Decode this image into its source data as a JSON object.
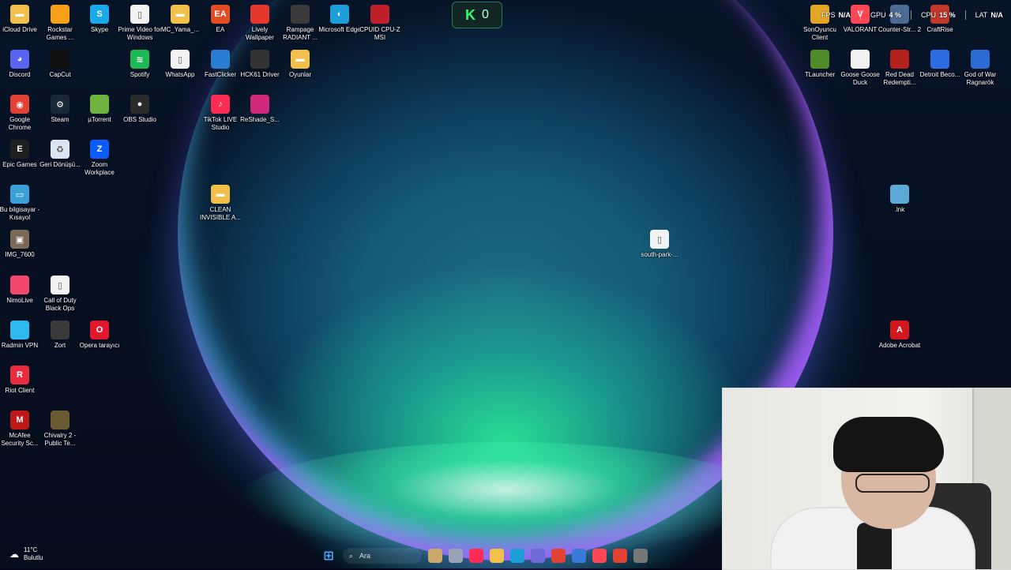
{
  "desktop": {
    "icons_left": [
      {
        "label": "iCloud Drive",
        "icon": "folder-icon",
        "color": "#f2c04a"
      },
      {
        "label": "Rockstar Games ...",
        "icon": "rockstar-icon",
        "color": "#f7a11a"
      },
      {
        "label": "Skype",
        "icon": "skype-icon",
        "color": "#19a8e8"
      },
      {
        "label": "Prime Video for Windows",
        "icon": "file-icon",
        "color": "#f2f2f2"
      },
      {
        "label": "MC_Yama_...",
        "icon": "folder-icon",
        "color": "#f2c04a"
      },
      {
        "label": "EA",
        "icon": "ea-icon",
        "color": "#e34b25"
      },
      {
        "label": "Lively Wallpaper",
        "icon": "lively-icon",
        "color": "#e6382d"
      },
      {
        "label": "Rampage RADIANT ...",
        "icon": "rampage-icon",
        "color": "#3a3a3a"
      },
      {
        "label": "Microsoft Edge",
        "icon": "edge-icon",
        "color": "#1c9ed8"
      },
      {
        "label": "CPUID CPU-Z MSI",
        "icon": "cpuz-icon",
        "color": "#c0202a"
      },
      {
        "label": "Discord",
        "icon": "discord-icon",
        "color": "#5865f2"
      },
      {
        "label": "CapCut",
        "icon": "capcut-icon",
        "color": "#101010"
      },
      {
        "label": "Spotify",
        "icon": "spotify-icon",
        "color": "#1db954"
      },
      {
        "label": "WhatsApp",
        "icon": "file-icon",
        "color": "#f2f2f2"
      },
      {
        "label": "FastClicker",
        "icon": "fastclicker-icon",
        "color": "#2a7bd2"
      },
      {
        "label": "HCK61 Driver",
        "icon": "hck-icon",
        "color": "#333333"
      },
      {
        "label": "Oyunlar",
        "icon": "folder-icon",
        "color": "#f2c04a"
      },
      {
        "label": "Google Chrome",
        "icon": "chrome-icon",
        "color": "#e34133"
      },
      {
        "label": "Steam",
        "icon": "steam-icon",
        "color": "#1b2838"
      },
      {
        "label": "µTorrent",
        "icon": "utorrent-icon",
        "color": "#6fb33f"
      },
      {
        "label": "OBS Studio",
        "icon": "obs-icon",
        "color": "#2b2b2b"
      },
      {
        "label": "TikTok LIVE Studio",
        "icon": "tiktok-icon",
        "color": "#fe2c55"
      },
      {
        "label": "ReShade_S...",
        "icon": "reshade-icon",
        "color": "#d22a7a"
      },
      {
        "label": "Epic Games",
        "icon": "epic-icon",
        "color": "#1f1f1f"
      },
      {
        "label": "Geri Dönüşü...",
        "icon": "recycle-bin-icon",
        "color": "#d9e6f2"
      },
      {
        "label": "Zoom Workplace",
        "icon": "zoom-icon",
        "color": "#0b5cff"
      },
      {
        "label": "Bu bilgisayar - Kısayol",
        "icon": "computer-icon",
        "color": "#3aa0d8"
      },
      {
        "label": "CLEAN INVISIBLE A...",
        "icon": "folder-icon",
        "color": "#f2c04a"
      },
      {
        "label": "IMG_7600",
        "icon": "image-icon",
        "color": "#7a6a55"
      },
      {
        "label": "south-park-...",
        "icon": "file-icon",
        "color": "#f2f2f2"
      },
      {
        "label": "NimoLive",
        "icon": "nimo-icon",
        "color": "#f2486b"
      },
      {
        "label": "Call of Duty Black Ops",
        "icon": "file-icon",
        "color": "#f2f2f2"
      },
      {
        "label": "Radmin VPN",
        "icon": "radmin-icon",
        "color": "#2fb8f0"
      },
      {
        "label": "Zort",
        "icon": "zort-icon",
        "color": "#3a3a3a"
      },
      {
        "label": "Opera tarayıcı",
        "icon": "opera-icon",
        "color": "#e0192e"
      },
      {
        "label": "Riot Client",
        "icon": "riot-icon",
        "color": "#e82c3e"
      },
      {
        "label": "McAfee Security Sc...",
        "icon": "mcafee-icon",
        "color": "#c01818"
      },
      {
        "label": "Chivalry 2 - Public Te...",
        "icon": "chivalry-icon",
        "color": "#6a5a32"
      }
    ],
    "icons_right": [
      {
        "label": "SonOyuncu Client",
        "icon": "sonoyuncu-icon",
        "color": "#e2a627"
      },
      {
        "label": "VALORANT",
        "icon": "valorant-icon",
        "color": "#ff4655"
      },
      {
        "label": "Counter-Str... 2",
        "icon": "cs2-icon",
        "color": "#4a6b96"
      },
      {
        "label": "CraftRise",
        "icon": "craftrise-icon",
        "color": "#c0392b"
      },
      {
        "label": "TLauncher",
        "icon": "tlauncher-icon",
        "color": "#4f8a2b"
      },
      {
        "label": "Goose Goose Duck",
        "icon": "goose-icon",
        "color": "#f1f1f1"
      },
      {
        "label": "Red Dead Redempti...",
        "icon": "rdr-icon",
        "color": "#b3221c"
      },
      {
        "label": "Detroit Beco...",
        "icon": "detroit-icon",
        "color": "#2b6de0"
      },
      {
        "label": "God of War Ragnarök",
        "icon": "gow-icon",
        "color": "#2d6bd4"
      },
      {
        "label": ".lnk",
        "icon": "shortcut-icon",
        "color": "#5aa9d6"
      },
      {
        "label": "Adobe Acrobat",
        "icon": "acrobat-icon",
        "color": "#d4171d"
      }
    ]
  },
  "game_hud": {
    "logo": "K",
    "count": "0"
  },
  "perf_overlay": {
    "fps_label": "FPS",
    "fps_value": "N/A",
    "gpu_label": "GPU",
    "gpu_value": "4 %",
    "cpu_label": "CPU",
    "cpu_value": "15 %",
    "lat_label": "LAT",
    "lat_value": "N/A"
  },
  "taskbar": {
    "weather_temp": "11°C",
    "weather_desc": "Bulutlu",
    "search_placeholder": "Ara",
    "apps": [
      "start-icon",
      "widgets-icon",
      "file-icon",
      "tiktok-icon",
      "folder-icon",
      "edge-icon",
      "powertoys-icon",
      "chrome-icon",
      "store-icon",
      "valorant-icon",
      "chrome-icon",
      "obs-icon"
    ]
  }
}
